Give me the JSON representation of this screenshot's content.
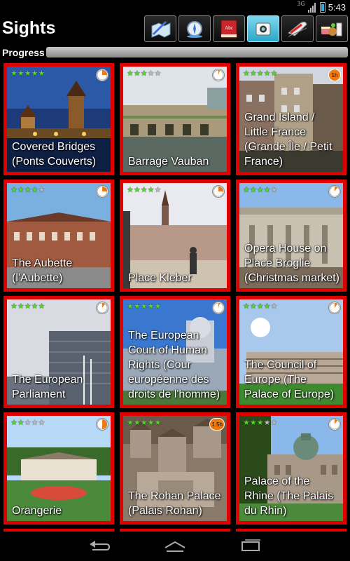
{
  "status_bar": {
    "network": "3G",
    "time": "5:43"
  },
  "header": {
    "title": "Sights",
    "toolbar": [
      {
        "icon": "map-pen-icon",
        "active": false
      },
      {
        "icon": "compass-icon",
        "active": false
      },
      {
        "icon": "dictionary-icon",
        "active": false,
        "book_text": "Abc"
      },
      {
        "icon": "camera-icon",
        "active": true
      },
      {
        "icon": "train-icon",
        "active": false
      },
      {
        "icon": "food-drink-icon",
        "active": false
      }
    ]
  },
  "progress": {
    "label": "Progress",
    "value": 0.0
  },
  "accent_color": "#e00000",
  "star_color": "#4ddc22",
  "sights": [
    {
      "title": "Covered Bridges (Ponts Couverts)",
      "stars": 5,
      "timer": "pie",
      "pie": 0.25,
      "photo": "bridges"
    },
    {
      "title": "Barrage Vauban",
      "stars": 3,
      "timer": "pie",
      "pie": 0.05,
      "photo": "barrage"
    },
    {
      "title": "Grand Island / Little France (Grande Île / Petit France)",
      "stars": 5,
      "timer": "badge",
      "badge": "1h",
      "photo": "island"
    },
    {
      "title": "The Aubette (l'Aubette)",
      "stars": 4,
      "timer": "pie",
      "pie": 0.25,
      "photo": "aubette"
    },
    {
      "title": "Place Kleber",
      "stars": 4,
      "timer": "pie",
      "pie": 0.25,
      "photo": "kleber"
    },
    {
      "title": "Opera House on Place Broglie (Christmas market)",
      "stars": 4,
      "timer": "pie",
      "pie": 0.1,
      "photo": "opera"
    },
    {
      "title": "The European Parliament",
      "stars": 5,
      "timer": "pie",
      "pie": 0.1,
      "photo": "parliament"
    },
    {
      "title": "The European Court of Human Rights (Cour européenne des droits de l'homme)",
      "stars": 5,
      "timer": "pie",
      "pie": 0.05,
      "photo": "court"
    },
    {
      "title": "The Council of Europe (The Palace of Europe)",
      "stars": 4,
      "timer": "pie",
      "pie": 0.1,
      "photo": "council"
    },
    {
      "title": "Orangerie",
      "stars": 2,
      "timer": "pie",
      "pie": 0.5,
      "photo": "orangerie"
    },
    {
      "title": "The Rohan Palace (Palais Rohan)",
      "stars": 5,
      "timer": "badge",
      "badge": "1.5h",
      "photo": "rohan"
    },
    {
      "title": "Palace of the Rhine (The Palais du Rhin)",
      "stars": 3,
      "timer": "pie",
      "pie": 0.1,
      "photo": "rhine"
    }
  ],
  "nav": [
    {
      "icon": "back-icon"
    },
    {
      "icon": "home-icon"
    },
    {
      "icon": "recent-apps-icon"
    }
  ]
}
